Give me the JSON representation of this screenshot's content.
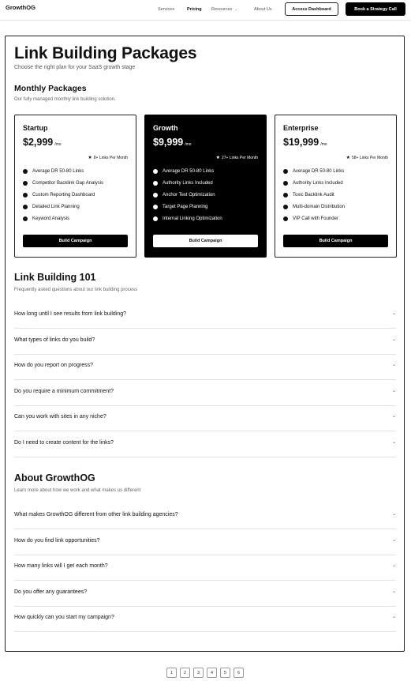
{
  "nav": {
    "logo": "GrowthOG",
    "links": [
      "Services",
      "Pricing",
      "Resources",
      "About Us"
    ],
    "resources_caret": "⌄",
    "access_label": "Access Dashboard",
    "cta_label": "Book a Strategy Call"
  },
  "hero": {
    "title": "Link Building Packages",
    "subtitle": "Choose the right plan for your SaaS growth stage"
  },
  "monthly": {
    "title": "Monthly Packages",
    "subtitle": "Our fully managed monthly link building solution."
  },
  "plans": [
    {
      "name": "Startup",
      "price": "$2,999",
      "period": "/mo",
      "links": "8+ Links Per Month",
      "features": [
        "Average DR 50-80 Links",
        "Competitor Backlink Gap Analysis",
        "Custom Reporting Dashboard",
        "Detailed Link Planning",
        "Keyword Analysis"
      ],
      "button": "Build Campaign"
    },
    {
      "name": "Growth",
      "price": "$9,999",
      "period": "/mo",
      "links": "27+ Links Per Month",
      "features": [
        "Average DR 50-80 Links",
        "Authority Links Included",
        "Anchor Text Optimization",
        "Target Page Planning",
        "Internal Linking Optimization"
      ],
      "button": "Build Campaign"
    },
    {
      "name": "Enterprise",
      "price": "$19,999",
      "period": "/mo",
      "links": "58+ Links Per Month",
      "features": [
        "Average DR 50-80 Links",
        "Authority Links Included",
        "Toxic Backlink Audit",
        "Multi-domain Distribution",
        "VIP Call with Founder"
      ],
      "button": "Build Campaign"
    }
  ],
  "faq101": {
    "title": "Link Building 101",
    "subtitle": "Frequently asked questions about our link building process",
    "questions": [
      "How long until I see results from link building?",
      "What types of links do you build?",
      "How do you report on progress?",
      "Do you require a minimum commitment?",
      "Can you work with sites in any niche?",
      "Do I need to create content for the links?"
    ]
  },
  "about": {
    "title": "About GrowthOG",
    "subtitle": "Learn more about how we work and what makes us different",
    "questions": [
      "What makes GrowthOG different from other link building agencies?",
      "How do you find link opportunities?",
      "How many links will I get each month?",
      "Do you offer any guarantees?",
      "How quickly can you start my campaign?"
    ]
  },
  "chevron": "⌄",
  "star": "★",
  "pagination": [
    "1",
    "2",
    "3",
    "4",
    "5",
    "6"
  ],
  "colors": {
    "primary": "#000000",
    "border": "#222222",
    "divider": "#e2e2e2",
    "muted": "#666666"
  }
}
